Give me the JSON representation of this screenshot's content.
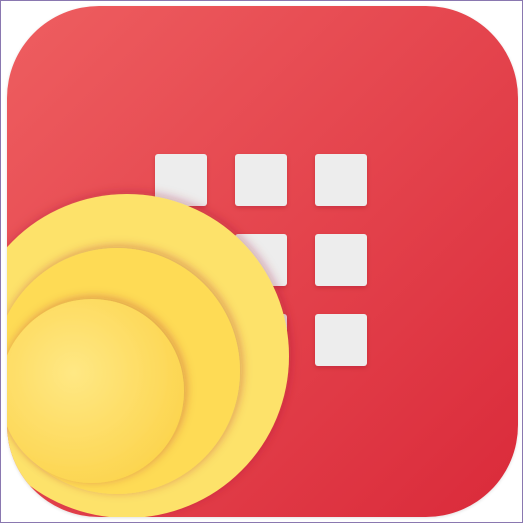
{
  "icon": {
    "name": "app-grid-icon",
    "colors": {
      "background_top": "#ee5e60",
      "background_bottom": "#da2a3a",
      "grid_tile": "#ededed",
      "sun_outer": "#fde26a",
      "sun_middle": "#fdd545",
      "sun_inner": "#fcd23a"
    },
    "grid": {
      "rows": 3,
      "cols": 3
    }
  }
}
